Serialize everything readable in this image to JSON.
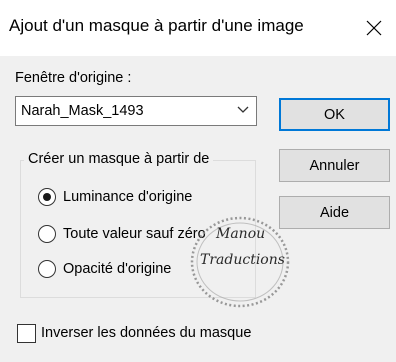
{
  "dialog": {
    "title": "Ajout d'un masque à partir d'une image",
    "close_icon": "close-icon"
  },
  "source": {
    "label": "Fenêtre d'origine :",
    "selected": "Narah_Mask_1493",
    "dropdown_icon": "chevron-down-icon"
  },
  "buttons": {
    "ok": "OK",
    "cancel": "Annuler",
    "help": "Aide"
  },
  "mask_group": {
    "legend": "Créer un masque à partir de",
    "options": [
      {
        "label": "Luminance d'origine",
        "checked": true
      },
      {
        "label": "Toute valeur sauf zéro",
        "checked": false
      },
      {
        "label": "Opacité d'origine",
        "checked": false
      }
    ]
  },
  "invert": {
    "label": "Inverser les données du masque",
    "checked": false
  },
  "watermark": {
    "line1": "Manou",
    "line2": "Traductions"
  }
}
